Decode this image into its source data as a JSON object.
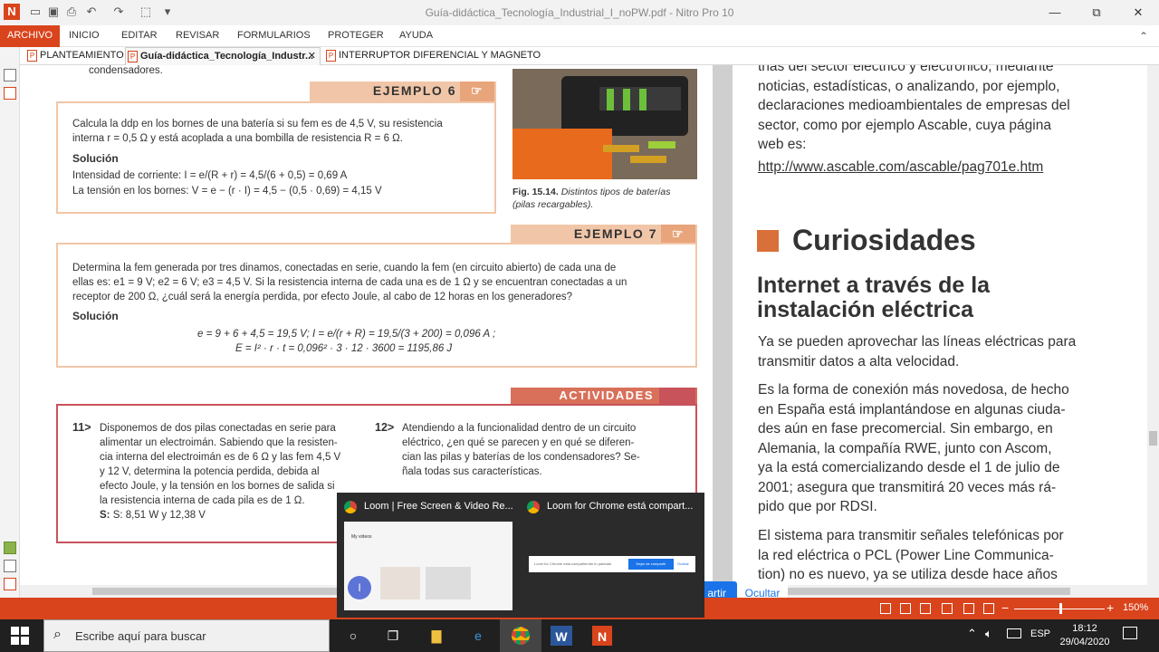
{
  "window": {
    "title": "Guía-didáctica_Tecnología_Industrial_I_noPW.pdf - Nitro Pro 10",
    "min": "—",
    "max": "⧉",
    "close": "✕",
    "logo": "N"
  },
  "ribbon": {
    "tabs": [
      "ARCHIVO",
      "INICIO",
      "EDITAR",
      "REVISAR",
      "FORMULARIOS",
      "PROTEGER",
      "AYUDA"
    ]
  },
  "doc_tabs": [
    {
      "label": "PLANTEAMIENTO"
    },
    {
      "label": "Guía-didáctica_Tecnología_Industr...",
      "close": "✕"
    },
    {
      "label": "INTERRUPTOR DIFERENCIAL Y MAGNETO..."
    }
  ],
  "left_page": {
    "top_fragment": "condensadores.",
    "ejemplo6": {
      "header": "EJEMPLO 6",
      "text1": "Calcula la ddp en los bornes de una batería si su fem es de 4,5 V, su resistencia",
      "text2": "interna r = 0,5 Ω y está acoplada a una bombilla de resistencia R = 6 Ω.",
      "sol": "Solución",
      "line1": "Intensidad de corriente: I = e/(R + r) = 4,5/(6 + 0,5) = 0,69 A",
      "line2": "La tensión en los bornes: V = e − (r · I) = 4,5 − (0,5 · 0,69) = 4,15 V"
    },
    "figure": {
      "caption_num": "Fig. 15.14.",
      "caption": "Distintos tipos de baterías",
      "caption2": "(pilas recargables)."
    },
    "ejemplo7": {
      "header": "EJEMPLO 7",
      "text1": "Determina la fem generada por tres dinamos, conectadas en serie, cuando la fem (en circuito abierto) de cada una de",
      "text2": "ellas es: e1 = 9 V; e2 = 6 V; e3 = 4,5 V. Si la resistencia interna de cada una es de 1 Ω y se encuentran conectadas a un",
      "text3": "receptor de 200 Ω, ¿cuál será la energía perdida, por efecto Joule, al cabo de 12 horas en los generadores?",
      "sol": "Solución",
      "eq1": "e = 9 + 6 + 4,5 = 19,5 V; I = e/(r + R) = 19,5/(3 + 200) = 0,096 A ;",
      "eq2": "E = I² · r · t = 0,096² · 3 · 12 · 3600 = 1195,86 J"
    },
    "actividades": {
      "header": "ACTIVIDADES",
      "n11": "11>",
      "a11": [
        "Disponemos de dos pilas conectadas en serie para",
        "alimentar un electroimán. Sabiendo que la resisten-",
        "cia interna del electroimán es de 6 Ω y las fem 4,5 V",
        "y 12 V, determina la potencia perdida, debida al",
        "efecto Joule, y la tensión en los bornes de salida si",
        "la resistencia interna de cada pila es de 1 Ω."
      ],
      "s11": "S: 8,51 W y 12,38 V",
      "n12": "12>",
      "a12": [
        "Atendiendo a la funcionalidad dentro de un circuito",
        "eléctrico, ¿en qué se parecen y en qué se diferen-",
        "cian las pilas y baterías de los condensadores? Se-",
        "ñala todas sus características."
      ]
    }
  },
  "right_page": {
    "lines_top": [
      "trias del sector eléctrico y electrónico, mediante",
      "noticias, estadísticas, o analizando, por ejemplo,",
      "declaraciones medioambientales de empresas del",
      "sector, como por ejemplo Ascable, cuya página",
      "web es:"
    ],
    "link": "http://www.ascable.com/ascable/pag701e.htm",
    "section": "Curiosidades",
    "subtitle1": "Internet a través de la",
    "subtitle2": "instalación eléctrica",
    "p1": [
      "Ya se pueden aprovechar las líneas eléctricas para",
      "transmitir datos a alta velocidad."
    ],
    "p2": [
      "Es la forma de conexión más novedosa, de hecho",
      "en España está implantándose en algunas ciuda-",
      "des aún en fase precomercial. Sin embargo, en",
      "Alemania, la compañía RWE, junto con Ascom,",
      "ya la está comercializando desde el 1 de julio de",
      "2001; asegura que transmitirá 20 veces más rá-",
      "pido que por RDSI."
    ],
    "p3": [
      "El sistema para transmitir señales telefónicas por",
      "la red eléctrica o PCL (Power  Line Communica-",
      "tion) no es nuevo, ya se utiliza desde hace años"
    ]
  },
  "popup": {
    "t1": "Loom | Free Screen & Video Re...",
    "t2": "Loom for Chrome está compart...",
    "thumb1_label": "My videos",
    "thumb2_text": "Loom for Chrome está compartiendo tu pantalla.",
    "thumb2_btn1": "Dejar de compartir",
    "thumb2_btn2": "Ocultar",
    "avatar": "I"
  },
  "share_bar": {
    "stop": "artir",
    "hide": "Ocultar"
  },
  "statusbar": {
    "zoom": "150%"
  },
  "taskbar": {
    "search_placeholder": "Escribe aquí para buscar",
    "lang": "ESP",
    "time": "18:12",
    "date": "29/04/2020"
  }
}
